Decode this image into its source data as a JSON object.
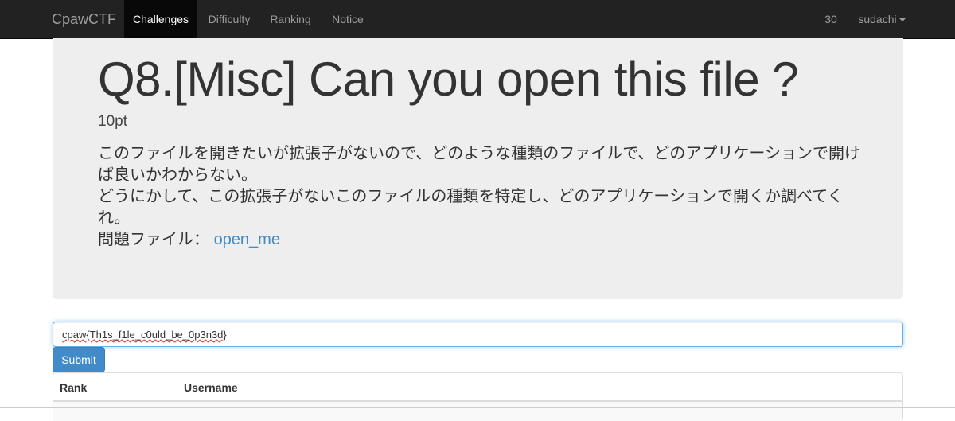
{
  "navbar": {
    "brand": "CpawCTF",
    "items": [
      {
        "label": "Challenges",
        "active": true
      },
      {
        "label": "Difficulty",
        "active": false
      },
      {
        "label": "Ranking",
        "active": false
      },
      {
        "label": "Notice",
        "active": false
      }
    ],
    "score": "30",
    "user": "sudachi"
  },
  "challenge": {
    "title": "Q8.[Misc] Can you open this file ?",
    "points": "10pt",
    "description_line1": "このファイルを開きたいが拡張子がないので、どのような種類のファイルで、どのアプリケーションで開けば良いかわからない。",
    "description_line2": "どうにかして、この拡張子がないこのファイルの種類を特定し、どのアプリケーションで開くか調べてくれ。",
    "file_label": "問題ファイル：",
    "file_link": "open_me"
  },
  "form": {
    "flag_value": "cpaw{Th1s_f1le_c0uld_be_0p3n3d}",
    "submit_label": "Submit"
  },
  "table": {
    "headers": [
      "Rank",
      "Username"
    ]
  },
  "colors": {
    "navbar_bg": "#222222",
    "jumbotron_bg": "#eeeeee",
    "link": "#428bca",
    "primary_button": "#428bca"
  }
}
